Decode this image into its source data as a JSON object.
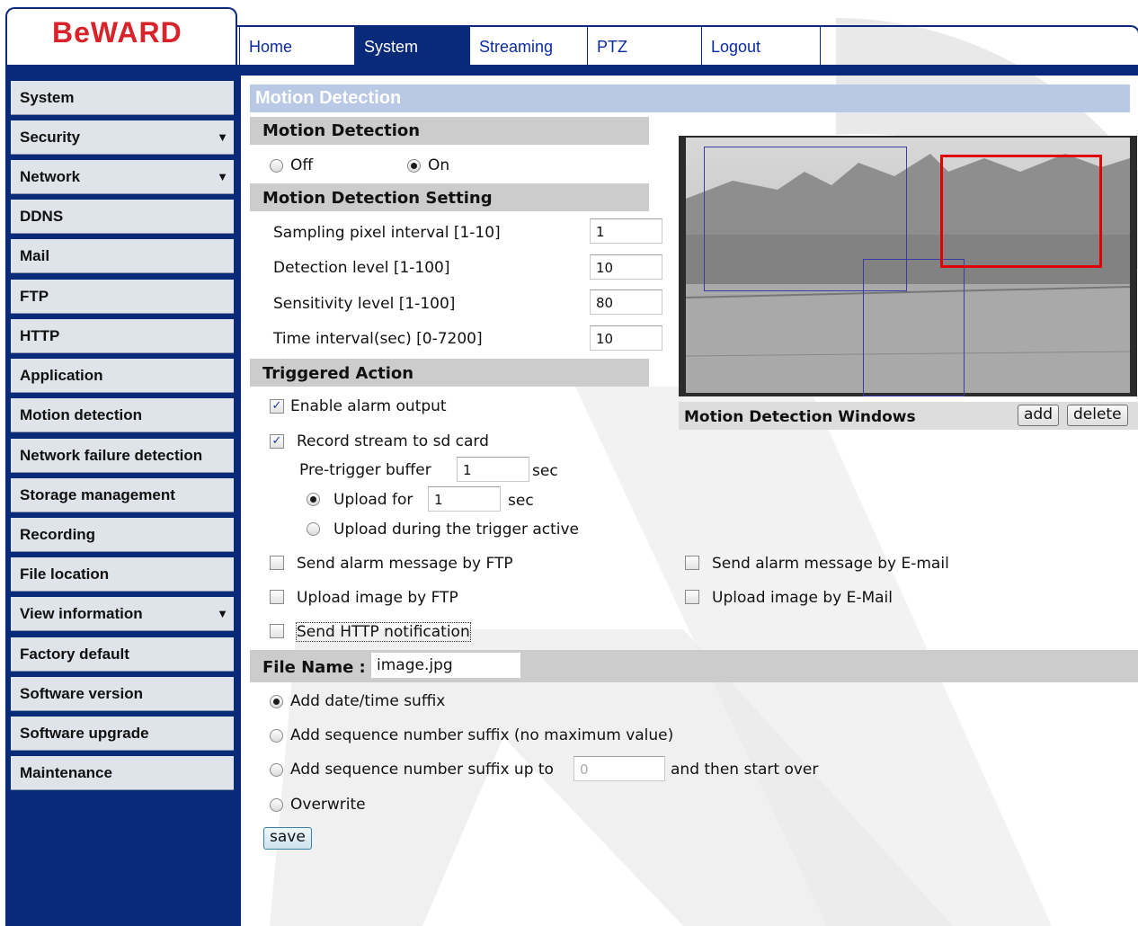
{
  "brand": {
    "logo_text": "BeWARD"
  },
  "nav": {
    "tabs": [
      {
        "label": "Home"
      },
      {
        "label": "System"
      },
      {
        "label": "Streaming"
      },
      {
        "label": "PTZ"
      },
      {
        "label": "Logout"
      }
    ],
    "active": "System"
  },
  "sidebar": {
    "items": [
      {
        "label": "System"
      },
      {
        "label": "Security",
        "expandable": true
      },
      {
        "label": "Network",
        "expandable": true
      },
      {
        "label": "DDNS"
      },
      {
        "label": "Mail"
      },
      {
        "label": "FTP"
      },
      {
        "label": "HTTP"
      },
      {
        "label": "Application"
      },
      {
        "label": "Motion detection"
      },
      {
        "label": "Network failure detection"
      },
      {
        "label": "Storage management"
      },
      {
        "label": "Recording"
      },
      {
        "label": "File location"
      },
      {
        "label": "View information",
        "expandable": true
      },
      {
        "label": "Factory default"
      },
      {
        "label": "Software version"
      },
      {
        "label": "Software upgrade"
      },
      {
        "label": "Maintenance"
      }
    ],
    "arrow_glyph": "▼"
  },
  "page": {
    "title": "Motion Detection"
  },
  "motion": {
    "section_title": "Motion Detection",
    "off_label": "Off",
    "on_label": "On",
    "selected": "On"
  },
  "settings": {
    "section_title": "Motion Detection Setting",
    "fields": [
      {
        "label": "Sampling pixel interval [1-10]",
        "value": "1"
      },
      {
        "label": "Detection level [1-100]",
        "value": "10"
      },
      {
        "label": "Sensitivity level [1-100]",
        "value": "80"
      },
      {
        "label": "Time interval(sec) [0-7200]",
        "value": "10"
      }
    ]
  },
  "triggered": {
    "section_title": "Triggered Action",
    "enable_alarm_output": {
      "label": "Enable alarm output",
      "checked": true
    },
    "record_sd": {
      "label": "Record stream to sd card",
      "checked": true
    },
    "pretrigger": {
      "label": "Pre-trigger buffer",
      "value": "1",
      "unit": "sec"
    },
    "upload_for": {
      "label": "Upload for",
      "value": "1",
      "unit": "sec",
      "selected": true
    },
    "upload_during": {
      "label": "Upload during the trigger active",
      "selected": false
    },
    "send_ftp": {
      "label": "Send alarm message by FTP",
      "checked": false
    },
    "send_email": {
      "label": "Send alarm message by E-mail",
      "checked": false
    },
    "upload_ftp": {
      "label": "Upload image by FTP",
      "checked": false
    },
    "upload_email": {
      "label": "Upload image by E-Mail",
      "checked": false
    },
    "send_http": {
      "label": "Send HTTP notification",
      "checked": false
    }
  },
  "file": {
    "label": "File Name :",
    "value": "image.jpg",
    "options": [
      {
        "label": "Add date/time suffix",
        "selected": true
      },
      {
        "label": "Add sequence number suffix (no maximum value)",
        "selected": false
      },
      {
        "label": "Add sequence number suffix up to",
        "selected": false,
        "input_value": "0",
        "suffix": "and then start over"
      },
      {
        "label": "Overwrite",
        "selected": false
      }
    ]
  },
  "windows": {
    "title": "Motion Detection Windows",
    "add_label": "add",
    "delete_label": "delete",
    "colors": {
      "window": "#3b3ba8",
      "selected": "#e00000"
    }
  },
  "actions": {
    "save_label": "save"
  },
  "theme": {
    "brand_red": "#d8232a",
    "nav_blue": "#082a78",
    "title_bar": "#b9c8e4",
    "section_gray": "#cccccc"
  }
}
